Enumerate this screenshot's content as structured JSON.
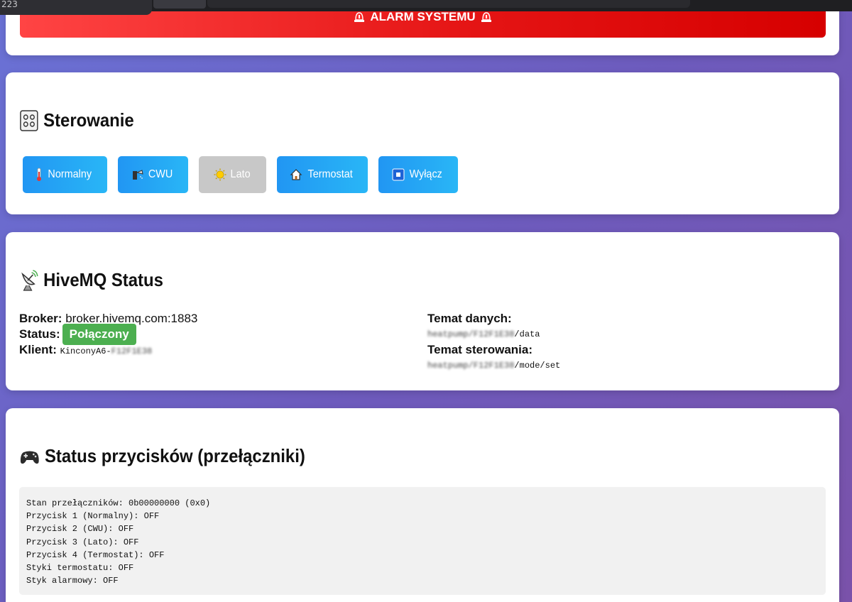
{
  "browser": {
    "tab_partial": "223"
  },
  "alarm": {
    "label": "ALARM SYSTEMU"
  },
  "control": {
    "title": "Sterowanie",
    "buttons": [
      {
        "label": "Normalny",
        "icon": "thermometer-icon",
        "enabled": true
      },
      {
        "label": "CWU",
        "icon": "shower-icon",
        "enabled": true
      },
      {
        "label": "Lato",
        "icon": "sun-icon",
        "enabled": false
      },
      {
        "label": "Termostat",
        "icon": "house-icon",
        "enabled": true
      },
      {
        "label": "Wyłącz",
        "icon": "stop-icon",
        "enabled": true
      }
    ]
  },
  "hivemq": {
    "title": "HiveMQ Status",
    "broker_label": "Broker:",
    "broker_value": "broker.hivemq.com:1883",
    "status_label": "Status:",
    "status_value": "Połączony",
    "client_label": "Klient:",
    "client_prefix": "KinconyA6-",
    "client_redacted": "F12F1E38",
    "data_topic_label": "Temat danych:",
    "data_topic_redacted": "heatpump/F12F1E38",
    "data_topic_suffix": "/data",
    "control_topic_label": "Temat sterowania:",
    "control_topic_redacted": "heatpump/F12F1E38",
    "control_topic_suffix": "/mode/set"
  },
  "switches": {
    "title": "Status przycisków (przełączniki)",
    "lines": [
      "Stan przełączników: 0b00000000 (0x0)",
      "Przycisk 1 (Normalny): OFF",
      "Przycisk 2 (CWU): OFF",
      "Przycisk 3 (Lato): OFF",
      "Przycisk 4 (Termostat): OFF",
      "Styki termostatu: OFF",
      "Styk alarmowy: OFF"
    ]
  },
  "colors": {
    "alarm_red": "#e51515",
    "button_blue": "#2196f3",
    "button_disabled": "#c8c8c8",
    "status_green": "#4caf50"
  }
}
